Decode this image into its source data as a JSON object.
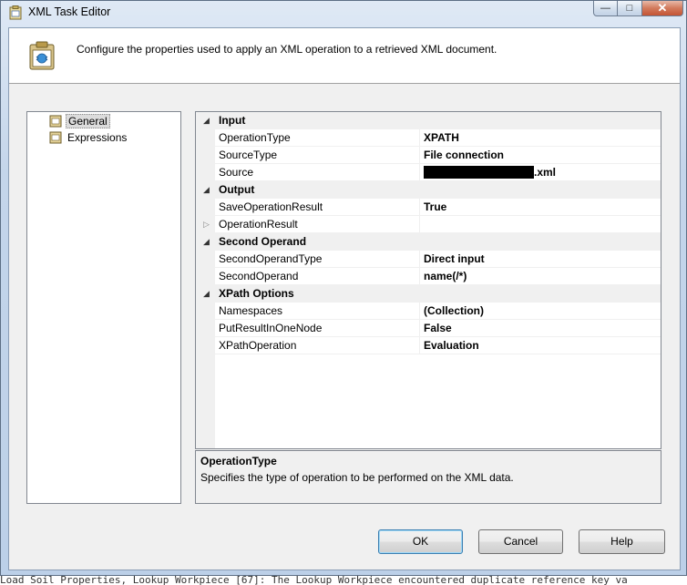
{
  "window": {
    "title": "XML Task Editor",
    "minimize_glyph": "—",
    "maximize_glyph": "□",
    "close_glyph": "✕"
  },
  "header": {
    "description": "Configure the properties used to apply an XML operation to a retrieved XML document."
  },
  "nav": {
    "items": [
      {
        "label": "General",
        "selected": true
      },
      {
        "label": "Expressions",
        "selected": false
      }
    ]
  },
  "grid": {
    "rows": [
      {
        "kind": "category",
        "name": "Input",
        "expanded": true
      },
      {
        "kind": "property",
        "name": "OperationType",
        "value": "XPATH"
      },
      {
        "kind": "property",
        "name": "SourceType",
        "value": "File connection"
      },
      {
        "kind": "property",
        "name": "Source",
        "value": ".xml",
        "redacted_prefix": true
      },
      {
        "kind": "category",
        "name": "Output",
        "expanded": true
      },
      {
        "kind": "property",
        "name": "SaveOperationResult",
        "value": "True"
      },
      {
        "kind": "property",
        "name": "OperationResult",
        "value": "",
        "expandable": true
      },
      {
        "kind": "category",
        "name": "Second Operand",
        "expanded": true
      },
      {
        "kind": "property",
        "name": "SecondOperandType",
        "value": "Direct input"
      },
      {
        "kind": "property",
        "name": "SecondOperand",
        "value": "name(/*)"
      },
      {
        "kind": "category",
        "name": "XPath Options",
        "expanded": true
      },
      {
        "kind": "property",
        "name": "Namespaces",
        "value": "(Collection)"
      },
      {
        "kind": "property",
        "name": "PutResultInOneNode",
        "value": "False"
      },
      {
        "kind": "property",
        "name": "XPathOperation",
        "value": "Evaluation"
      }
    ]
  },
  "description_panel": {
    "title": "OperationType",
    "text": "Specifies the type of operation to be performed on the XML data."
  },
  "buttons": {
    "ok": "OK",
    "cancel": "Cancel",
    "help": "Help"
  },
  "background_text": "Load Soil Properties, Lookup Workpiece [67]: The Lookup Workpiece encountered duplicate reference key va"
}
